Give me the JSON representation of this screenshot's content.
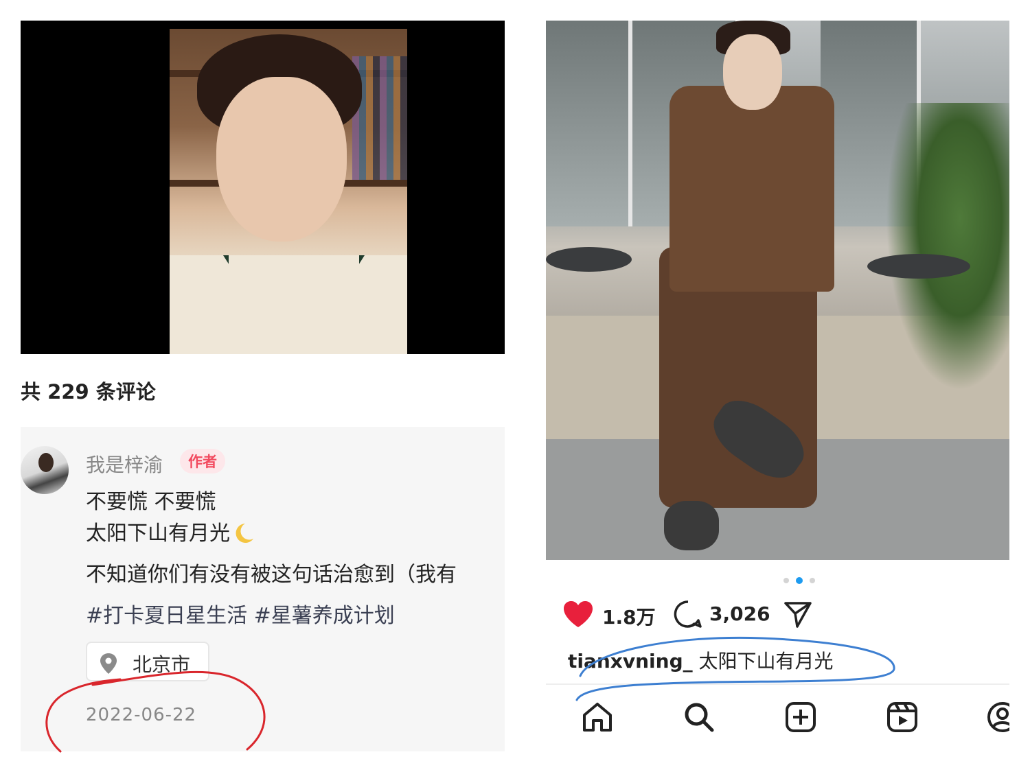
{
  "left": {
    "comments_count": "共 229 条评论",
    "comment": {
      "username": "我是梓渝",
      "author_badge": "作者",
      "line1": "不要慌 不要慌",
      "line2": "太阳下山有月光",
      "line3": "不知道你们有没有被这句话治愈到（我有",
      "hashtags": "#打卡夏日星生活 #星薯养成计划",
      "location": "北京市",
      "date": "2022-06-22"
    },
    "moon_icon": "crescent-moon-emoji",
    "location_icon": "map-pin-icon"
  },
  "right": {
    "likes": "1.8万",
    "comments": "3,026",
    "caption_user": "tianxvning_",
    "caption_text": " 太阳下山有月光",
    "carousel": {
      "count": 3,
      "active": 2
    },
    "icons": [
      "heart-icon",
      "comment-bubble-icon",
      "share-send-icon"
    ],
    "tab_icons": [
      "home-icon",
      "search-icon",
      "create-post-icon",
      "reels-icon",
      "profile-icon"
    ],
    "colors": {
      "like_red": "#e8203c",
      "dot_active": "#1d9bf0"
    }
  },
  "annotation_colors": {
    "left_circle": "#d9262c",
    "right_circle": "#3d7fd1"
  }
}
